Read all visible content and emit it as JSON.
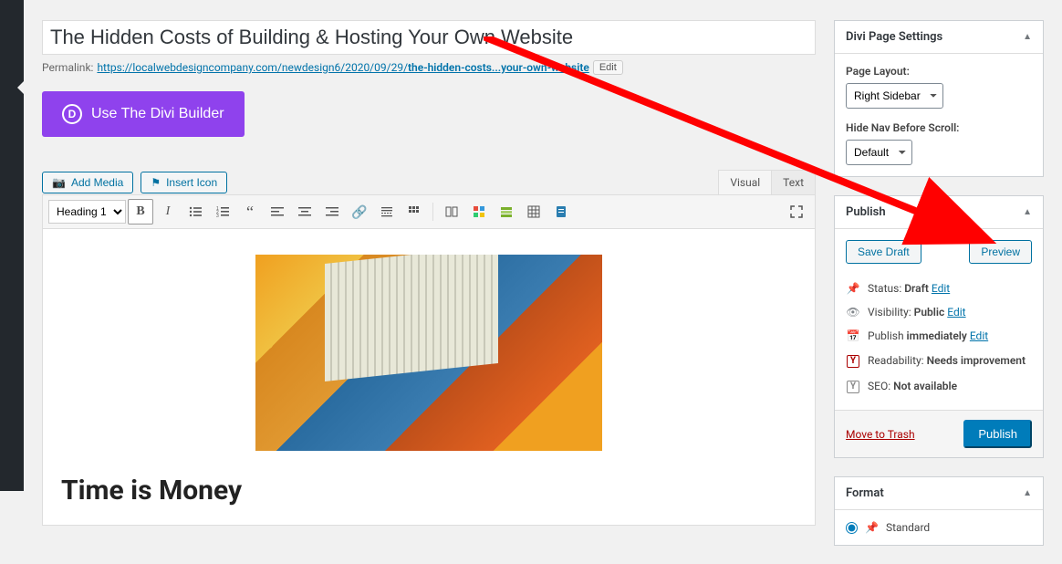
{
  "post": {
    "title": "The Hidden Costs of Building & Hosting Your Own Website",
    "permalink_label": "Permalink:",
    "permalink_base": "https://localwebdesigncompany.com/newdesign6/2020/09/29/",
    "permalink_slug": "the-hidden-costs...your-own-website",
    "edit_slug_label": "Edit"
  },
  "divi": {
    "button_label": "Use The Divi Builder",
    "icon_letter": "D"
  },
  "media": {
    "add_media_label": "Add Media",
    "insert_icon_label": "Insert Icon"
  },
  "editor_tabs": {
    "visual": "Visual",
    "text": "Text"
  },
  "toolbar": {
    "format_value": "Heading 1"
  },
  "content": {
    "heading": "Time is Money"
  },
  "divi_panel": {
    "title": "Divi Page Settings",
    "page_layout_label": "Page Layout:",
    "page_layout_value": "Right Sidebar",
    "hide_nav_label": "Hide Nav Before Scroll:",
    "hide_nav_value": "Default"
  },
  "publish_panel": {
    "title": "Publish",
    "save_draft": "Save Draft",
    "preview": "Preview",
    "status_label": "Status:",
    "status_value": "Draft",
    "visibility_label": "Visibility:",
    "visibility_value": "Public",
    "schedule_label": "Publish",
    "schedule_value": "immediately",
    "readability_label": "Readability:",
    "readability_value": "Needs improvement",
    "seo_label": "SEO:",
    "seo_value": "Not available",
    "edit_link": "Edit",
    "trash": "Move to Trash",
    "publish_button": "Publish"
  },
  "format_panel": {
    "title": "Format",
    "standard": "Standard"
  },
  "colors": {
    "accent_purple": "#8f42ed",
    "wp_blue": "#007cba",
    "arrow_red": "#ff0000"
  }
}
